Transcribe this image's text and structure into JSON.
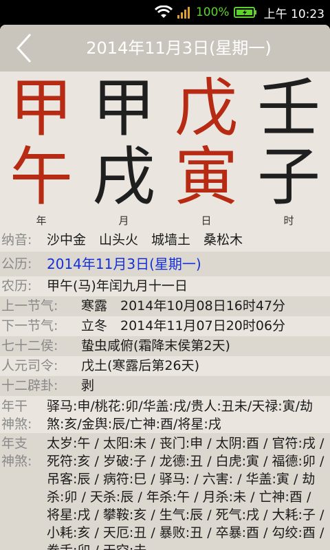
{
  "status": {
    "battery_pct": "100%",
    "time": "上午 10:23",
    "battery_color": "#5cd42a"
  },
  "header": {
    "title": "2014年11月3日(星期一)"
  },
  "bazi": {
    "pillars": [
      {
        "gan": "甲",
        "zhi": "午",
        "label": "年",
        "gan_color": "red",
        "zhi_color": "red"
      },
      {
        "gan": "甲",
        "zhi": "戌",
        "label": "月",
        "gan_color": "black",
        "zhi_color": "black"
      },
      {
        "gan": "戊",
        "zhi": "寅",
        "label": "日",
        "gan_color": "red",
        "zhi_color": "red"
      },
      {
        "gan": "壬",
        "zhi": "子",
        "label": "时",
        "gan_color": "black",
        "zhi_color": "black"
      }
    ]
  },
  "info": {
    "nayin": {
      "label": "纳音:",
      "value": "沙中金　山头火　城墙土　桑松木"
    },
    "gongli": {
      "label": "公历:",
      "value": "2014年11月3日(星期一)"
    },
    "nongli": {
      "label": "农历:",
      "value": "甲午(马)年闰九月十一日"
    },
    "shang_jieqi": {
      "label": "上一节气:",
      "value": "寒露　2014年10月08日16时47分"
    },
    "xia_jieqi": {
      "label": "下一节气:",
      "value": "立冬　2014年11月07日20时06分"
    },
    "hou": {
      "label": "七十二侯:",
      "value": "蛰虫咸俯(霜降末侯第2天)"
    },
    "siling": {
      "label": "人元司令:",
      "value": "戊土(寒露后第26天)"
    },
    "bigua": {
      "label": "十二辟卦:",
      "value": "剥"
    },
    "niangan": {
      "label_1": "年干",
      "label_2": "神煞:",
      "value": "驿马:申/桃花:卯/华盖:戌/贵人:丑未/天禄:寅/劫煞:亥/金舆:辰/亡神:酉/将星:戌"
    },
    "nianzhi": {
      "label_1": "年支",
      "label_2": "神煞:",
      "value": "太岁:午 / 太阳:未 / 丧门:申 / 太阴:酉 / 官符:戌 / 死符:亥 / 岁破:子 / 龙德:丑 / 白虎:寅 / 福德:卯 / 吊客:辰 / 病符:巳 / 驿马: / 六害: / 华盖:寅 / 劫杀:卯 / 天杀:辰 / 年杀:午 / 月杀:未 / 亡神:酉 / 将星:戌 / 攀鞍:亥 / 生气:辰 / 死气:戌 / 大耗:子 / 小耗:亥 / 天厄:丑 / 暴败:丑 / 卒暴:酉 / 勾绞:酉 / 卷舌:卯 / 天空:未"
    }
  }
}
